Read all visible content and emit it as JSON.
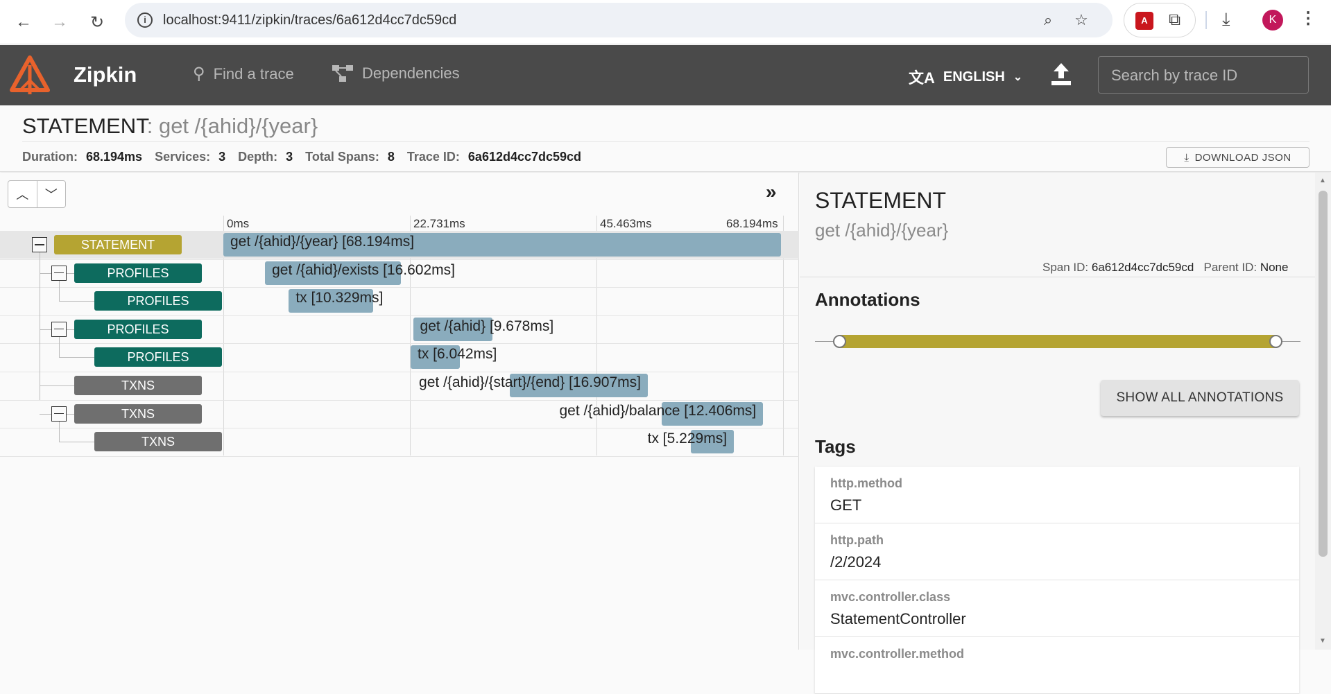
{
  "browser": {
    "url": "localhost:9411/zipkin/traces/6a612d4cc7dc59cd",
    "avatar_letter": "K",
    "pdf_label": "A"
  },
  "header": {
    "app_name": "Zipkin",
    "nav": [
      {
        "label": "Find a trace",
        "icon": "search-icon"
      },
      {
        "label": "Dependencies",
        "icon": "dependencies-icon"
      }
    ],
    "language": "ENGLISH",
    "search_placeholder": "Search by trace ID",
    "colors": {
      "header_bg": "#4a4a4a",
      "logo": "#e8622c"
    }
  },
  "summary": {
    "title_service": "STATEMENT",
    "title_sep": ":",
    "title_span": "get /{ahid}/{year}",
    "stats": [
      {
        "key": "Duration:",
        "value": "68.194ms"
      },
      {
        "key": "Services:",
        "value": "3"
      },
      {
        "key": "Depth:",
        "value": "3"
      },
      {
        "key": "Total Spans:",
        "value": "8"
      },
      {
        "key": "Trace ID:",
        "value": "6a612d4cc7dc59cd"
      }
    ],
    "download_label": "DOWNLOAD JSON"
  },
  "timeline": {
    "ticks": [
      "0ms",
      "22.731ms",
      "45.463ms",
      "68.194ms"
    ],
    "total_ms": 68.194,
    "spans": [
      {
        "service": "STATEMENT",
        "kind": "stmt",
        "depth": 0,
        "collapsible": true,
        "start_ms": 0,
        "duration_ms": 68.194,
        "label": "get /{ahid}/{year} [68.194ms]",
        "selected": true
      },
      {
        "service": "PROFILES",
        "kind": "prof",
        "depth": 1,
        "collapsible": true,
        "start_ms": 5.1,
        "duration_ms": 16.602,
        "label": "get /{ahid}/exists [16.602ms]"
      },
      {
        "service": "PROFILES",
        "kind": "prof",
        "depth": 2,
        "collapsible": false,
        "start_ms": 8.0,
        "duration_ms": 10.329,
        "label": "tx [10.329ms]"
      },
      {
        "service": "PROFILES",
        "kind": "prof",
        "depth": 1,
        "collapsible": true,
        "start_ms": 23.2,
        "duration_ms": 9.678,
        "label": "get /{ahid} [9.678ms]"
      },
      {
        "service": "PROFILES",
        "kind": "prof",
        "depth": 2,
        "collapsible": false,
        "start_ms": 22.9,
        "duration_ms": 6.042,
        "label": "tx [6.042ms]"
      },
      {
        "service": "TXNS",
        "kind": "txn",
        "depth": 1,
        "collapsible": false,
        "start_ms": 35.0,
        "duration_ms": 16.907,
        "label": "get /{ahid}/{start}/{end} [16.907ms]"
      },
      {
        "service": "TXNS",
        "kind": "txn",
        "depth": 1,
        "collapsible": true,
        "start_ms": 53.6,
        "duration_ms": 12.406,
        "label": "get /{ahid}/balance [12.406ms]"
      },
      {
        "service": "TXNS",
        "kind": "txn",
        "depth": 2,
        "collapsible": false,
        "start_ms": 57.2,
        "duration_ms": 5.229,
        "label": "tx [5.229ms]"
      }
    ]
  },
  "detail": {
    "service": "STATEMENT",
    "span_name": "get /{ahid}/{year}",
    "span_id_label": "Span ID:",
    "span_id": "6a612d4cc7dc59cd",
    "parent_id_label": "Parent ID:",
    "parent_id": "None",
    "annotations_heading": "Annotations",
    "show_all_label": "SHOW ALL ANNOTATIONS",
    "tags_heading": "Tags",
    "tags": [
      {
        "key": "http.method",
        "value": "GET"
      },
      {
        "key": "http.path",
        "value": "/2/2024"
      },
      {
        "key": "mvc.controller.class",
        "value": "StatementController"
      },
      {
        "key": "mvc.controller.method",
        "value": ""
      }
    ]
  }
}
